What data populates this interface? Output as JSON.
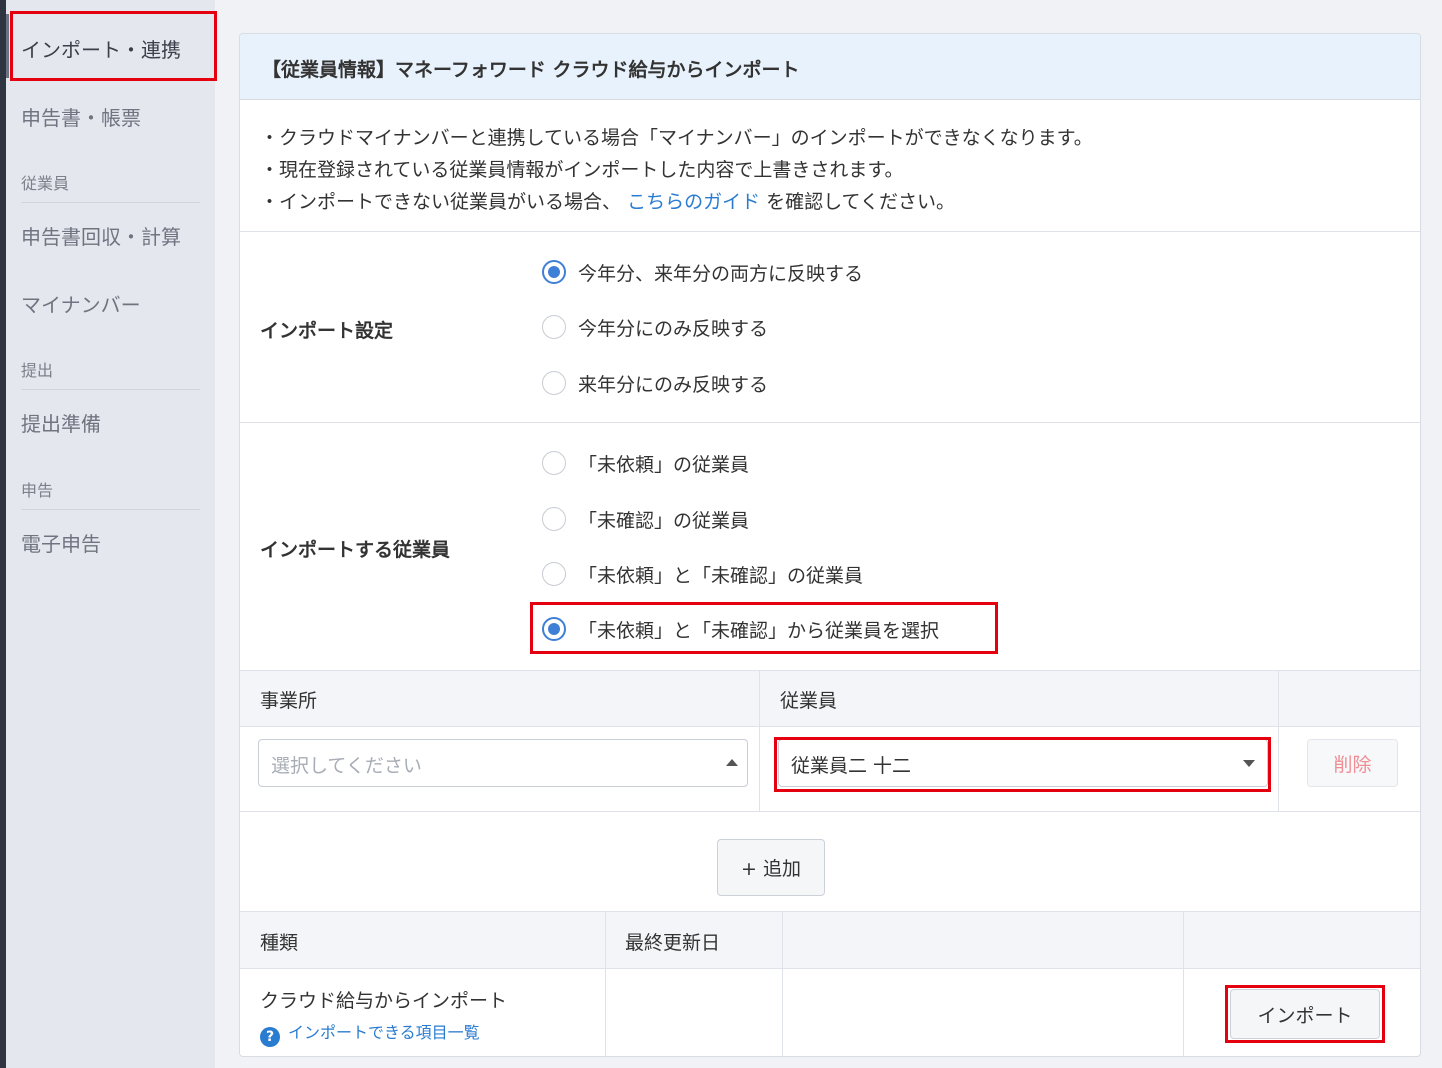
{
  "sidebar": {
    "items": [
      {
        "label": "インポート・連携",
        "active": true
      },
      {
        "label": "申告書・帳票"
      },
      {
        "section": "従業員"
      },
      {
        "label": "申告書回収・計算"
      },
      {
        "label": "マイナンバー"
      },
      {
        "section": "提出"
      },
      {
        "label": "提出準備"
      },
      {
        "section": "申告"
      },
      {
        "label": "電子申告"
      }
    ]
  },
  "panel": {
    "title": "【従業員情報】マネーフォワード クラウド給与からインポート",
    "notes": {
      "line1": "・クラウドマイナンバーと連携している場合「マイナンバー」のインポートができなくなります。",
      "line2": "・現在登録されている従業員情報がインポートした内容で上書きされます。",
      "line3_pre": "・インポートできない従業員がいる場合、",
      "line3_link": "こちらのガイド",
      "line3_post": "を確認してください。"
    },
    "import_setting": {
      "label": "インポート設定",
      "options": [
        {
          "label": "今年分、来年分の両方に反映する",
          "checked": true
        },
        {
          "label": "今年分にのみ反映する",
          "checked": false
        },
        {
          "label": "来年分にのみ反映する",
          "checked": false
        }
      ]
    },
    "import_employees": {
      "label": "インポートする従業員",
      "options": [
        {
          "label": "「未依頼」の従業員",
          "checked": false
        },
        {
          "label": "「未確認」の従業員",
          "checked": false
        },
        {
          "label": "「未依頼」と「未確認」の従業員",
          "checked": false
        },
        {
          "label": "「未依頼」と「未確認」から従業員を選択",
          "checked": true
        }
      ]
    },
    "employee_table": {
      "col_office": "事業所",
      "col_employee": "従業員",
      "office_placeholder": "選択してください",
      "employee_value": "従業員二 十二",
      "delete_label": "削除",
      "add_label": "+ 追加"
    },
    "import_table": {
      "col_type": "種類",
      "col_updated": "最終更新日",
      "row_type": "クラウド給与からインポート",
      "row_link": "インポートできる項目一覧",
      "help_glyph": "?",
      "import_label": "インポート"
    }
  },
  "colors": {
    "accent": "#3f7fd6",
    "link": "#2a7cd1",
    "highlight": "#e4000f",
    "header_bg": "#e8f2fc"
  }
}
